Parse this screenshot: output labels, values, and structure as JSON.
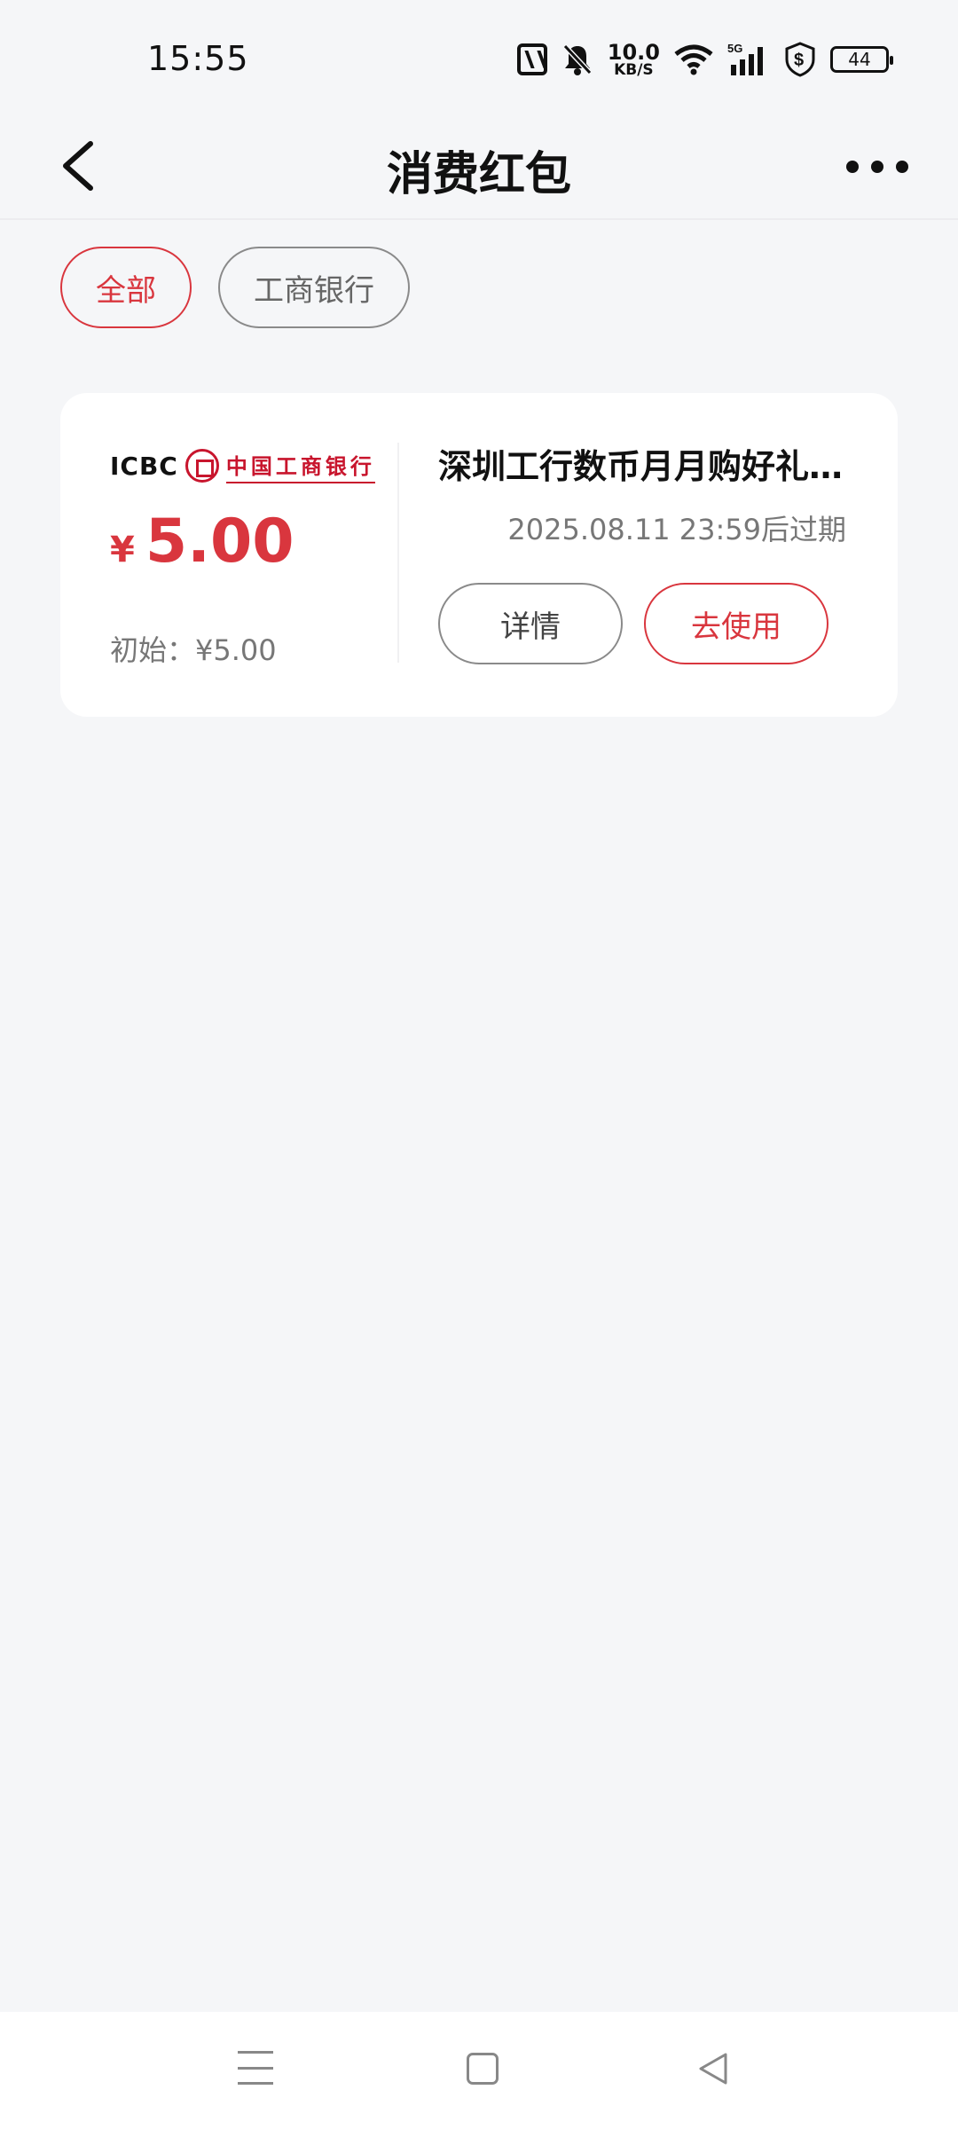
{
  "status_bar": {
    "time": "15:55",
    "net_speed_value": "10.0",
    "net_speed_unit": "KB/S",
    "network": "5G",
    "battery": "44",
    "icons": [
      "nfc-icon",
      "mute-bell-icon",
      "wifi-icon",
      "signal-icon",
      "shield-dollar-icon",
      "battery-icon"
    ]
  },
  "header": {
    "title": "消费红包",
    "back_icon": "chevron-left-icon",
    "more_icon": "more-dots-icon"
  },
  "filters": [
    {
      "label": "全部",
      "active": true
    },
    {
      "label": "工商银行",
      "active": false
    }
  ],
  "coupon": {
    "bank_abbr": "ICBC",
    "bank_name": "中国工商银行",
    "currency_symbol": "¥",
    "amount": "5.00",
    "initial_label": "初始：¥5.00",
    "title": "深圳工行数币月月购好礼...",
    "expiry": "2025.08.11 23:59后过期",
    "detail_button": "详情",
    "use_button": "去使用"
  },
  "colors": {
    "accent": "#d9363e",
    "bank_brand": "#c8152d",
    "background": "#f5f6f8"
  },
  "nav_bar": {
    "icons": [
      "menu-icon",
      "home-square-icon",
      "back-triangle-icon"
    ]
  }
}
